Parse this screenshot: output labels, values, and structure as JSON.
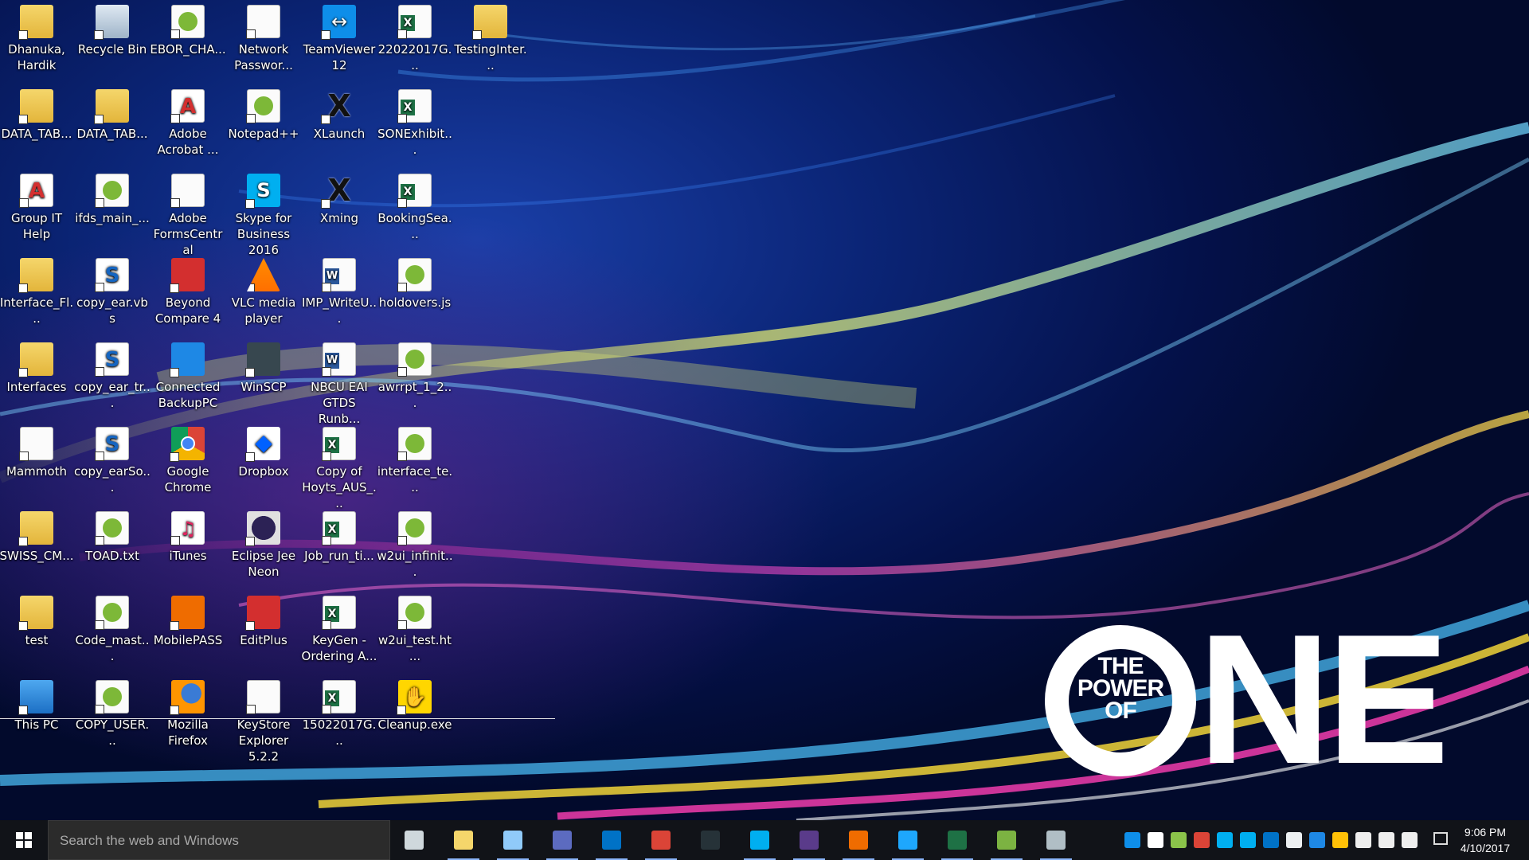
{
  "wallpaper": {
    "logo_line1": "THE",
    "logo_line2": "POWER",
    "logo_line3": "OF",
    "logo_big": "NE"
  },
  "desktop": {
    "icons": [
      {
        "label": "Dhanuka, Hardik",
        "icon": "user-folder-icon",
        "kind": "folder"
      },
      {
        "label": "DATA_TAB...",
        "icon": "folder-icon",
        "kind": "folder"
      },
      {
        "label": "Group IT Help",
        "icon": "help-document-icon",
        "kind": "pdf"
      },
      {
        "label": "Interface_Fl...",
        "icon": "folder-icon",
        "kind": "folder"
      },
      {
        "label": "Interfaces",
        "icon": "folder-icon",
        "kind": "folder"
      },
      {
        "label": "Mammoth",
        "icon": "mammoth-app-icon",
        "kind": "doc"
      },
      {
        "label": "SWISS_CM...",
        "icon": "folder-icon",
        "kind": "folder"
      },
      {
        "label": "test",
        "icon": "folder-icon",
        "kind": "folder"
      },
      {
        "label": "This PC",
        "icon": "computer-icon",
        "kind": "pc"
      },
      {
        "label": "Recycle Bin",
        "icon": "recycle-bin-icon",
        "kind": "bin"
      },
      {
        "label": "DATA_TAB...",
        "icon": "zipped-folder-icon",
        "kind": "folder"
      },
      {
        "label": "ifds_main_...",
        "icon": "notepadpp-file-icon",
        "kind": "note"
      },
      {
        "label": "copy_ear.vbs",
        "icon": "script-file-icon",
        "kind": "script"
      },
      {
        "label": "copy_ear_tr...",
        "icon": "script-file-icon",
        "kind": "script"
      },
      {
        "label": "copy_earSo...",
        "icon": "script-file-icon",
        "kind": "script"
      },
      {
        "label": "TOAD.txt",
        "icon": "notepadpp-file-icon",
        "kind": "note"
      },
      {
        "label": "Code_mast...",
        "icon": "notepadpp-file-icon",
        "kind": "note"
      },
      {
        "label": "COPY_USER...",
        "icon": "notepadpp-file-icon",
        "kind": "note"
      },
      {
        "label": "EBOR_CHA...",
        "icon": "notepadpp-file-icon",
        "kind": "note"
      },
      {
        "label": "Adobe Acrobat ...",
        "icon": "acrobat-icon",
        "kind": "pdf"
      },
      {
        "label": "Adobe FormsCentral",
        "icon": "formscentral-icon",
        "kind": "doc"
      },
      {
        "label": "Beyond Compare 4",
        "icon": "beyond-compare-icon",
        "kind": "red"
      },
      {
        "label": "Connected BackupPC",
        "icon": "shield-backup-icon",
        "kind": "blue"
      },
      {
        "label": "Google Chrome",
        "icon": "chrome-icon",
        "kind": "chrome"
      },
      {
        "label": "iTunes",
        "icon": "itunes-icon",
        "kind": "itunes"
      },
      {
        "label": "MobilePASS",
        "icon": "mobilepass-icon",
        "kind": "orange"
      },
      {
        "label": "Mozilla Firefox",
        "icon": "firefox-icon",
        "kind": "firefox"
      },
      {
        "label": "Network Passwor...",
        "icon": "lock-icon",
        "kind": "doc"
      },
      {
        "label": "Notepad++",
        "icon": "notepadpp-icon",
        "kind": "note"
      },
      {
        "label": "Skype for Business 2016",
        "icon": "skype-icon",
        "kind": "skype"
      },
      {
        "label": "VLC media player",
        "icon": "vlc-icon",
        "kind": "vlc"
      },
      {
        "label": "WinSCP",
        "icon": "winscp-icon",
        "kind": "dark"
      },
      {
        "label": "Dropbox",
        "icon": "dropbox-icon",
        "kind": "dropbox"
      },
      {
        "label": "Eclipse Jee Neon",
        "icon": "eclipse-icon",
        "kind": "eclipse"
      },
      {
        "label": "EditPlus",
        "icon": "editplus-icon",
        "kind": "red"
      },
      {
        "label": "KeyStore Explorer 5.2.2",
        "icon": "keys-icon",
        "kind": "doc"
      },
      {
        "label": "TeamViewer 12",
        "icon": "teamviewer-icon",
        "kind": "tv"
      },
      {
        "label": "XLaunch",
        "icon": "xlaunch-icon",
        "kind": "x"
      },
      {
        "label": "Xming",
        "icon": "xming-icon",
        "kind": "x"
      },
      {
        "label": "IMP_WriteU...",
        "icon": "word-file-icon",
        "kind": "word"
      },
      {
        "label": "NBCU EAI GTDS Runb...",
        "icon": "word-file-icon",
        "kind": "word"
      },
      {
        "label": "Copy of Hoyts_AUS_...",
        "icon": "excel-file-icon",
        "kind": "excel"
      },
      {
        "label": "Job_run_ti...",
        "icon": "excel-file-icon",
        "kind": "excel"
      },
      {
        "label": "KeyGen - Ordering A...",
        "icon": "excel-file-icon",
        "kind": "excel"
      },
      {
        "label": "15022017G...",
        "icon": "excel-file-icon",
        "kind": "excel"
      },
      {
        "label": "22022017G...",
        "icon": "excel-file-icon",
        "kind": "excel"
      },
      {
        "label": "SONExhibit...",
        "icon": "excel-file-icon",
        "kind": "excel"
      },
      {
        "label": "BookingSea...",
        "icon": "excel-file-icon",
        "kind": "excel"
      },
      {
        "label": "holdovers.js",
        "icon": "notepadpp-file-icon",
        "kind": "note"
      },
      {
        "label": "awrrpt_1_2...",
        "icon": "notepadpp-file-icon",
        "kind": "note"
      },
      {
        "label": "interface_te...",
        "icon": "notepadpp-file-icon",
        "kind": "note"
      },
      {
        "label": "w2ui_infinit...",
        "icon": "notepadpp-file-icon",
        "kind": "note"
      },
      {
        "label": "w2ui_test.ht...",
        "icon": "notepadpp-file-icon",
        "kind": "note"
      },
      {
        "label": "Cleanup.exe",
        "icon": "cleanup-icon",
        "kind": "cleanup"
      },
      {
        "label": "TestingInter...",
        "icon": "zipped-folder-icon",
        "kind": "folder"
      }
    ]
  },
  "taskbar": {
    "search_placeholder": "Search the web and Windows",
    "pinned": [
      {
        "name": "task-view-icon",
        "color": "#cfd8dc"
      },
      {
        "name": "file-explorer-icon",
        "color": "#f5d66b"
      },
      {
        "name": "app-icon",
        "color": "#90caf9"
      },
      {
        "name": "network-icon",
        "color": "#5c6bc0"
      },
      {
        "name": "outlook-icon",
        "color": "#0072c6"
      },
      {
        "name": "chrome-icon",
        "color": "#db4437"
      },
      {
        "name": "terminal-icon",
        "color": "#263238"
      },
      {
        "name": "skype-icon",
        "color": "#00aff0"
      },
      {
        "name": "eclipse-icon",
        "color": "#5a3b8a"
      },
      {
        "name": "mobilepass-icon",
        "color": "#ef6c00"
      },
      {
        "name": "internet-explorer-icon",
        "color": "#1ea7fd"
      },
      {
        "name": "excel-icon",
        "color": "#1e7145"
      },
      {
        "name": "android-studio-icon",
        "color": "#7cb342"
      },
      {
        "name": "paint-icon",
        "color": "#b0bec5"
      }
    ],
    "tray": [
      {
        "name": "teamviewer-tray-icon",
        "color": "#0e8ee9"
      },
      {
        "name": "dropbox-tray-icon",
        "color": "#ffffff"
      },
      {
        "name": "app-tray-icon",
        "color": "#8bc34a"
      },
      {
        "name": "chrome-tray-icon",
        "color": "#db4437"
      },
      {
        "name": "skype-business-tray-icon",
        "color": "#00aff0"
      },
      {
        "name": "skype-tray-icon",
        "color": "#00aff0"
      },
      {
        "name": "outlook-tray-icon",
        "color": "#0072c6"
      },
      {
        "name": "printer-tray-icon",
        "color": "#eceff1"
      },
      {
        "name": "onedrive-tray-icon",
        "color": "#1e88e5"
      },
      {
        "name": "security-tray-icon",
        "color": "#ffc107"
      },
      {
        "name": "battery-icon",
        "color": "#eeeeee"
      },
      {
        "name": "wifi-icon",
        "color": "#eeeeee"
      },
      {
        "name": "volume-muted-icon",
        "color": "#eeeeee"
      }
    ],
    "time": "9:06 PM",
    "date": "4/10/2017"
  }
}
